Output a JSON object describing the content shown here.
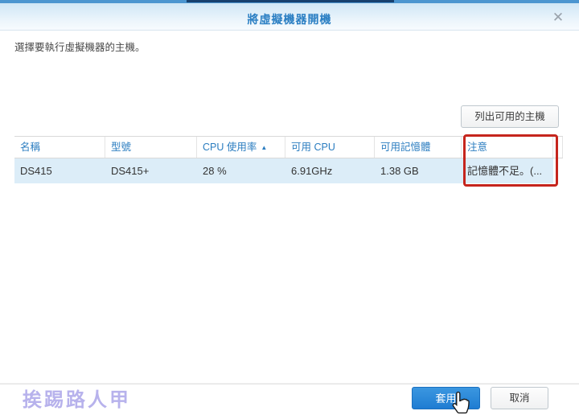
{
  "icons": {
    "close": "✕",
    "sort_asc": "▲"
  },
  "dialog": {
    "title": "將虛擬機器開機",
    "subtitle": "選擇要執行虛擬機器的主機。"
  },
  "actions": {
    "list_hosts": "列出可用的主機",
    "apply": "套用",
    "cancel": "取消"
  },
  "table": {
    "columns": [
      {
        "label": "名稱"
      },
      {
        "label": "型號"
      },
      {
        "label": "CPU 使用率",
        "sort": "ascending"
      },
      {
        "label": "可用 CPU"
      },
      {
        "label": "可用記憶體"
      },
      {
        "label": "注意"
      }
    ],
    "rows": [
      {
        "name": "DS415",
        "model": "DS415+",
        "cpu_usage": "28 %",
        "available_cpu": "6.91GHz",
        "available_memory": "1.38 GB",
        "note": "記憶體不足。(..."
      }
    ]
  },
  "watermark": "挨踢路人甲",
  "colors": {
    "accent_blue": "#2b7fc3",
    "apply_blue": "#2787d7",
    "selected_row": "#dcedf8",
    "highlight_red": "#c5251d"
  }
}
